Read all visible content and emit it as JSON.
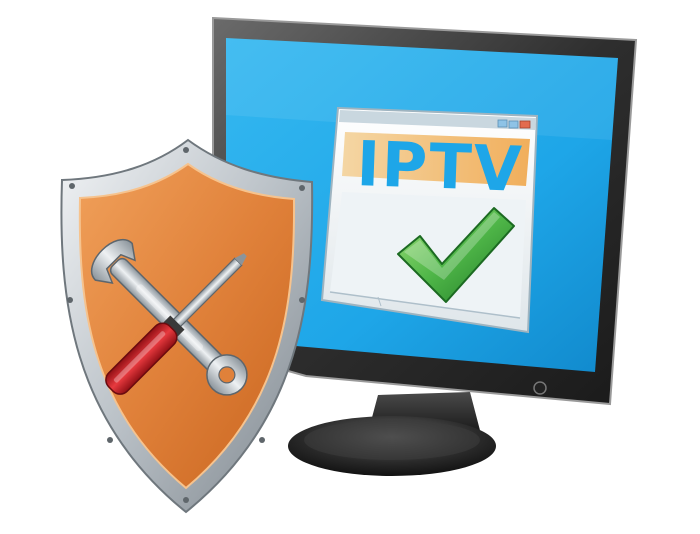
{
  "window": {
    "heading": "IPTV"
  },
  "icons": {
    "monitor": "monitor-icon",
    "window": "app-window-icon",
    "check": "checkmark-icon",
    "shield": "shield-icon",
    "tools": "wrench-screwdriver-icon"
  },
  "colors": {
    "screen": "#1ea6e8",
    "monitor_frame": "#3a3a3a",
    "shield_orange": "#e0813a",
    "shield_silver": "#c9ced3",
    "check_green": "#4fb648",
    "screwdriver_red": "#d2232a",
    "heading_blue": "#1ea6e8"
  }
}
